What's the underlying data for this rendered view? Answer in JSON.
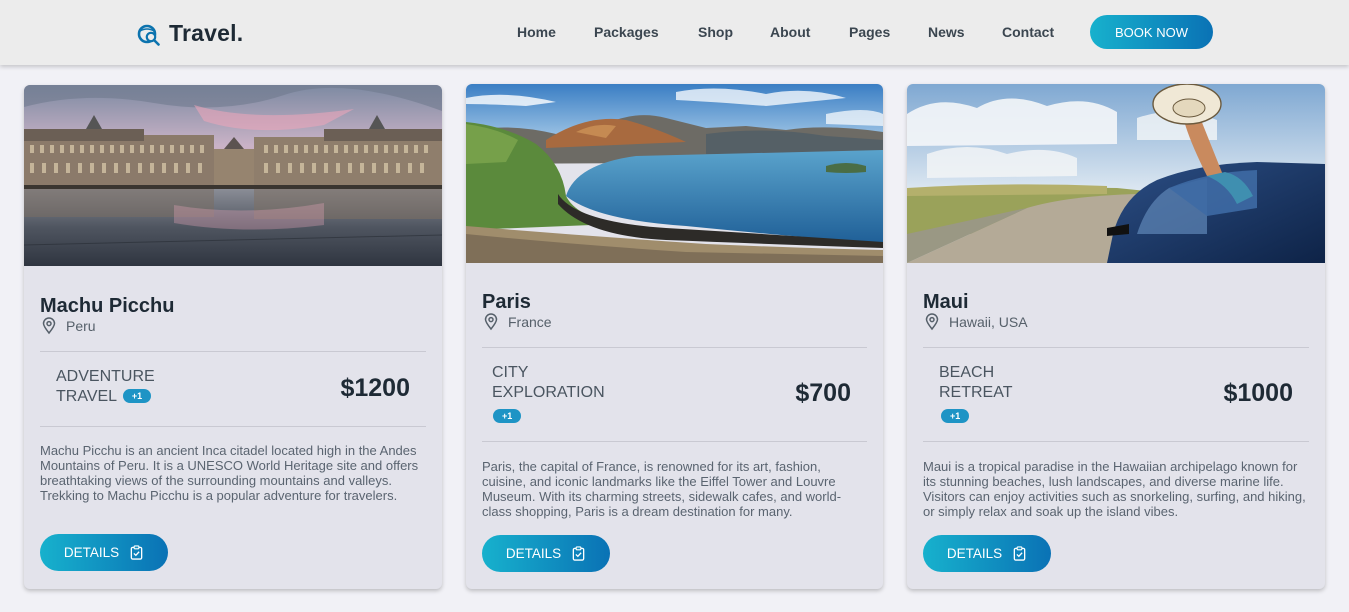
{
  "brand": {
    "name": "Travel."
  },
  "nav": {
    "items": [
      {
        "label": "Home"
      },
      {
        "label": "Packages"
      },
      {
        "label": "Shop"
      },
      {
        "label": "About"
      },
      {
        "label": "Pages"
      },
      {
        "label": "News"
      },
      {
        "label": "Contact"
      }
    ],
    "book_label": "BOOK NOW"
  },
  "colors": {
    "accent_start": "#17b1cd",
    "accent_end": "#0a72b5",
    "badge": "#1e94c5"
  },
  "cards": [
    {
      "title": "Machu Picchu",
      "location": "Peru",
      "type_line1": "ADVENTURE",
      "type_line2": "TRAVEL",
      "badge": "+1",
      "price": "$1200",
      "description": "Machu Picchu is an ancient Inca citadel located high in the Andes Mountains of Peru. It is a UNESCO World Heritage site and offers breathtaking views of the surrounding mountains and valleys. Trekking to Machu Picchu is a popular adventure for travelers.",
      "button": "DETAILS",
      "icon": "clipboard-check-icon"
    },
    {
      "title": "Paris",
      "location": "France",
      "type_line1": "CITY",
      "type_line2": "EXPLORATION",
      "badge": "+1",
      "price": "$700",
      "description": "Paris, the capital of France, is renowned for its art, fashion, cuisine, and iconic landmarks like the Eiffel Tower and Louvre Museum. With its charming streets, sidewalk cafes, and world-class shopping, Paris is a dream destination for many.",
      "button": "DETAILS",
      "icon": "clipboard-check-icon"
    },
    {
      "title": "Maui",
      "location": "Hawaii, USA",
      "type_line1": "BEACH",
      "type_line2": "RETREAT",
      "badge": "+1",
      "price": "$1000",
      "description": "Maui is a tropical paradise in the Hawaiian archipelago known for its stunning beaches, lush landscapes, and diverse marine life. Visitors can enjoy activities such as snorkeling, surfing, and hiking, or simply relax and soak up the island vibes.",
      "button": "DETAILS",
      "icon": "clipboard-check-icon"
    }
  ]
}
